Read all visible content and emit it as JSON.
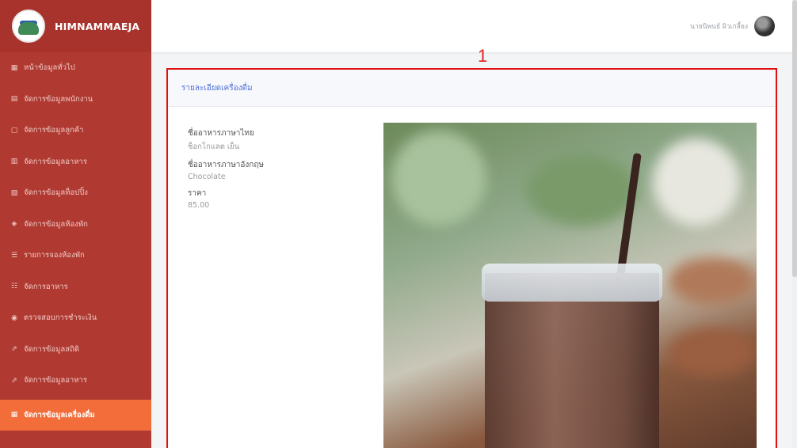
{
  "brand": {
    "name": "HIMNAMMAEJA"
  },
  "sidebar": {
    "items": [
      {
        "icon": "dashboard-icon",
        "label": "หน้าข้อมูลทั่วไป"
      },
      {
        "icon": "employee-icon",
        "label": "จัดการข้อมูลพนักงาน"
      },
      {
        "icon": "customer-icon",
        "label": "จัดการข้อมูลลูกค้า"
      },
      {
        "icon": "food-icon",
        "label": "จัดการข้อมูลอาหาร"
      },
      {
        "icon": "topping-icon",
        "label": "จัดการข้อมูลท็อปปิ้ง"
      },
      {
        "icon": "room-icon",
        "label": "จัดการข้อมูลห้องพัก"
      },
      {
        "icon": "booking-icon",
        "label": "รายการจองห้องพัก"
      },
      {
        "icon": "order-icon",
        "label": "จัดการอาหาร"
      },
      {
        "icon": "check-icon",
        "label": "ตรวจสอบการชำระเงิน"
      },
      {
        "icon": "report-icon",
        "label": "จัดการข้อมูลสถิติ"
      },
      {
        "icon": "stats-icon",
        "label": "จัดการข้อมูลอาหาร"
      },
      {
        "icon": "drink-icon",
        "label": "จัดการข้อมูลเครื่องดื่ม",
        "active": true
      }
    ]
  },
  "topbar": {
    "user_name": "นายนิพนธ์ ผิวเกลี้ยง"
  },
  "annotation": {
    "number": "1"
  },
  "card": {
    "title": "รายละเอียดเครื่องดื่ม",
    "fields": [
      {
        "label": "ชื่ออาหารภาษาไทย",
        "value": "ช็อกโกแลต เย็น"
      },
      {
        "label": "ชื่ออาหารภาษาอังกฤษ",
        "value": "Chocolate"
      },
      {
        "label": "ราคา",
        "value": "85.00"
      }
    ]
  },
  "colors": {
    "sidebar_bg": "#b03a32",
    "active_item": "#f26d3a",
    "title_blue": "#4e6fd6",
    "annotation_red": "#e01010"
  }
}
